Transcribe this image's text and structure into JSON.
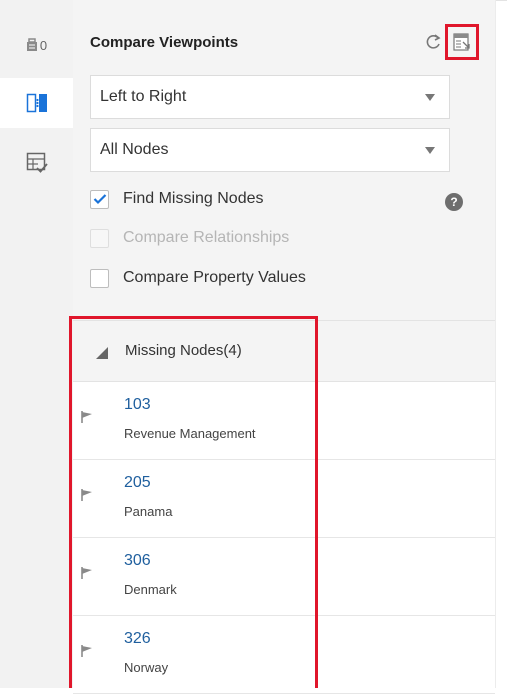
{
  "rail": {
    "items": [
      {
        "name": "inventory-icon",
        "badge": "0"
      },
      {
        "name": "compare-icon"
      },
      {
        "name": "validate-icon"
      }
    ]
  },
  "panel": {
    "title": "Compare Viewpoints",
    "direction_select": {
      "value": "Left to Right"
    },
    "nodes_select": {
      "value": "All Nodes"
    },
    "options": [
      {
        "label": "Find Missing Nodes",
        "checked": true,
        "disabled": false
      },
      {
        "label": "Compare Relationships",
        "checked": false,
        "disabled": true
      },
      {
        "label": "Compare Property Values",
        "checked": false,
        "disabled": false
      }
    ],
    "help_icon": "?"
  },
  "results": {
    "section_label": "Missing Nodes(4)",
    "nodes": [
      {
        "id": "103",
        "name": "Revenue Management"
      },
      {
        "id": "205",
        "name": "Panama"
      },
      {
        "id": "306",
        "name": "Denmark"
      },
      {
        "id": "326",
        "name": "Norway"
      }
    ]
  },
  "colors": {
    "highlight": "#e0162b",
    "accent": "#1a73d9",
    "link": "#1f5f9e"
  }
}
